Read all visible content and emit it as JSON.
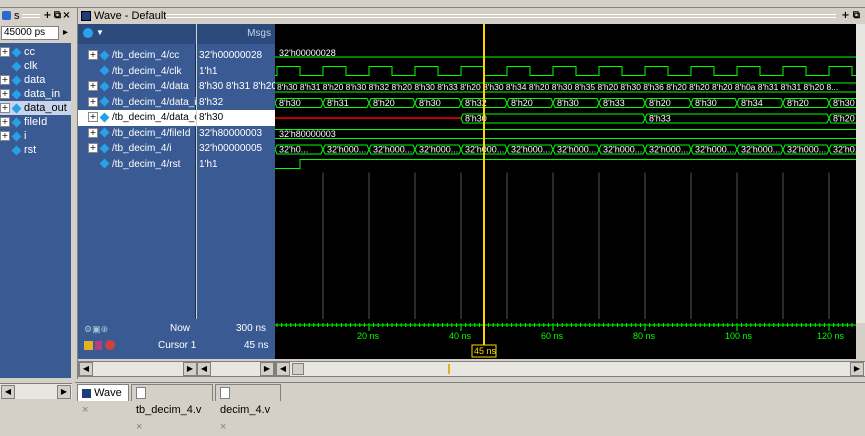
{
  "objects_panel": {
    "title": "s",
    "time_value": "45000",
    "time_unit": "ps",
    "items": [
      {
        "expand": "+",
        "label": "cc"
      },
      {
        "expand": "",
        "label": "clk"
      },
      {
        "expand": "+",
        "label": "data"
      },
      {
        "expand": "+",
        "label": "data_in"
      },
      {
        "expand": "+",
        "label": "data_out"
      },
      {
        "expand": "+",
        "label": "fileId"
      },
      {
        "expand": "+",
        "label": "i"
      },
      {
        "expand": "",
        "label": "rst"
      }
    ]
  },
  "wave_window": {
    "title": "Wave - Default",
    "msgs_header": "Msgs",
    "signals": [
      {
        "expand": "+",
        "name": "/tb_decim_4/cc",
        "value": "32'h00000028"
      },
      {
        "expand": "",
        "name": "/tb_decim_4/clk",
        "value": "1'h1"
      },
      {
        "expand": "+",
        "name": "/tb_decim_4/data",
        "value": "8'h30 8'h31 8'h20 ..."
      },
      {
        "expand": "+",
        "name": "/tb_decim_4/data_in",
        "value": "8'h32"
      },
      {
        "expand": "+",
        "name": "/tb_decim_4/data_out",
        "value": "8'h30"
      },
      {
        "expand": "+",
        "name": "/tb_decim_4/fileId",
        "value": "32'h80000003"
      },
      {
        "expand": "+",
        "name": "/tb_decim_4/i",
        "value": "32'h00000005"
      },
      {
        "expand": "",
        "name": "/tb_decim_4/rst",
        "value": "1'h1"
      }
    ],
    "now_label": "Now",
    "now_value": "300 ns",
    "cursor_label": "Cursor 1",
    "cursor_value": "45 ns",
    "cursor_time_badge": "45 ns",
    "time_ticks": [
      "20 ns",
      "40 ns",
      "60 ns",
      "80 ns",
      "100 ns",
      "120 ns"
    ],
    "trace_texts": {
      "cc": [
        "32'h00000028"
      ],
      "data": [
        "8'h30 8'h31 8'h20 8'h30 8'h32 8'h20 8'h30 8'h33 8'h20 8'h30 8'h34 8'h20 8'h30 8'h35 8'h20 8'h30 8'h36 8'h20 8'h20 8'h20 8'h0a 8'h31 8'h31 8'h20 8..."
      ],
      "data_in": [
        "8'h30",
        "8'h31",
        "8'h20",
        "8'h30",
        "8'h32",
        "8'h20",
        "8'h30",
        "8'h33",
        "8'h20",
        "8'h30",
        "8'h34",
        "8'h20",
        "8'h30"
      ],
      "data_out": [
        "8'h30",
        "8'h33",
        "8'h20"
      ],
      "fileId": [
        "32'h80000003"
      ],
      "i": [
        "32'h0...",
        "32'h000...",
        "32'h000...",
        "32'h000...",
        "32'h000...",
        "32'h000...",
        "32'h000...",
        "32'h000...",
        "32'h000...",
        "32'h000...",
        "32'h000...",
        "32'h000...",
        "32'h0..."
      ]
    }
  },
  "tabs": [
    {
      "label": "Wave"
    },
    {
      "label": "tb_decim_4.v"
    },
    {
      "label": "decim_4.v"
    }
  ],
  "colors": {
    "wave_bg": "#000000",
    "signal_green": "#00ff00",
    "cursor_yellow": "#ffd700",
    "panel_blue": "#3a5a94",
    "highlight_red": "#ff0000"
  }
}
